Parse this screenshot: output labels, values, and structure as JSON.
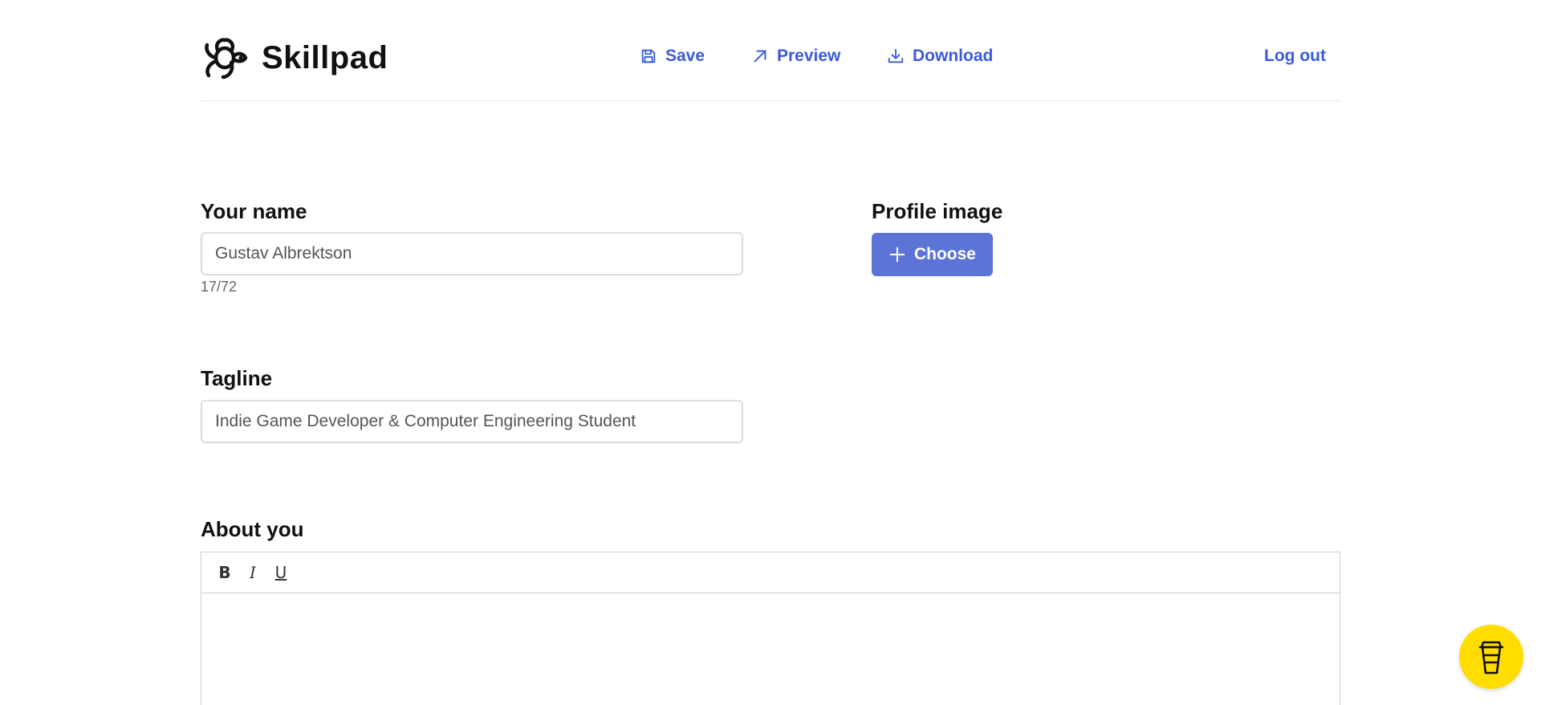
{
  "app": {
    "name": "Skillpad"
  },
  "nav": {
    "save": "Save",
    "preview": "Preview",
    "download": "Download",
    "logout": "Log out"
  },
  "form": {
    "name_label": "Your name",
    "name_value": "Gustav Albrektson",
    "name_counter": "17/72",
    "profile_image_label": "Profile image",
    "choose_label": "Choose",
    "tagline_label": "Tagline",
    "tagline_value": "Indie Game Developer & Computer Engineering Student",
    "about_label": "About you"
  },
  "editor": {
    "bold": "B",
    "italic": "I",
    "underline": "U"
  },
  "colors": {
    "accent": "#3b5bdb",
    "button": "#5b74d6",
    "coffee": "#ffdd00"
  },
  "icons": {
    "logo": "turtle-logo-icon",
    "save": "floppy-disk-icon",
    "preview": "arrow-up-right-icon",
    "download": "download-icon",
    "choose": "plus-icon",
    "coffee": "coffee-cup-icon"
  }
}
